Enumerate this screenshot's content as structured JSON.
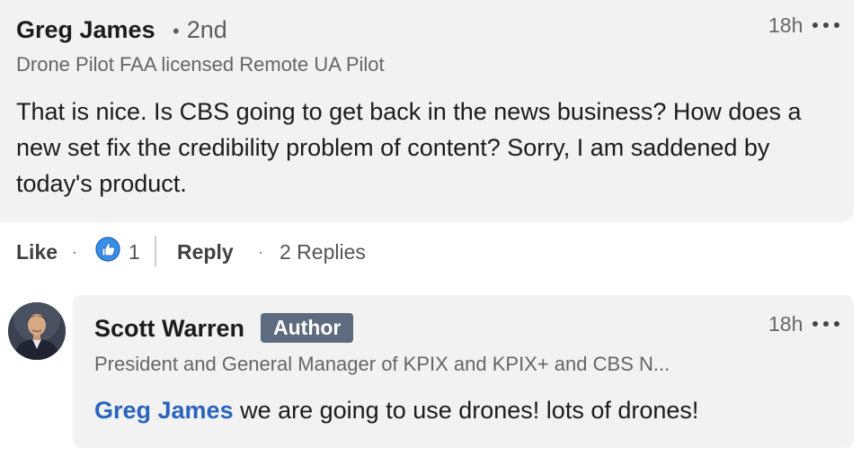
{
  "comment": {
    "author": "Greg James",
    "degree": "2nd",
    "degree_dot": "•",
    "headline": "Drone Pilot FAA licensed Remote UA Pilot",
    "time": "18h",
    "body": "That is nice. Is CBS going to get back in the news business? How does a new set fix the credibility problem of content? Sorry, I am saddened by today's product.",
    "actions": {
      "like_label": "Like",
      "separator": "·",
      "reaction_count": "1",
      "reply_label": "Reply",
      "replies_label": "2 Replies"
    }
  },
  "reply": {
    "author": "Scott Warren",
    "badge": "Author",
    "headline": "President and General Manager of KPIX and KPIX+ and CBS N...",
    "time": "18h",
    "mention": "Greg James",
    "body": " we are going to use drones! lots of drones!"
  },
  "colors": {
    "card_bg": "#f2f2f2",
    "badge_bg": "#5d6b7e",
    "mention": "#2a64bd",
    "reaction_blue": "#378fe9"
  },
  "icons": {
    "more": "more-options-icon",
    "reaction": "like-reaction-icon",
    "avatar": "avatar"
  }
}
